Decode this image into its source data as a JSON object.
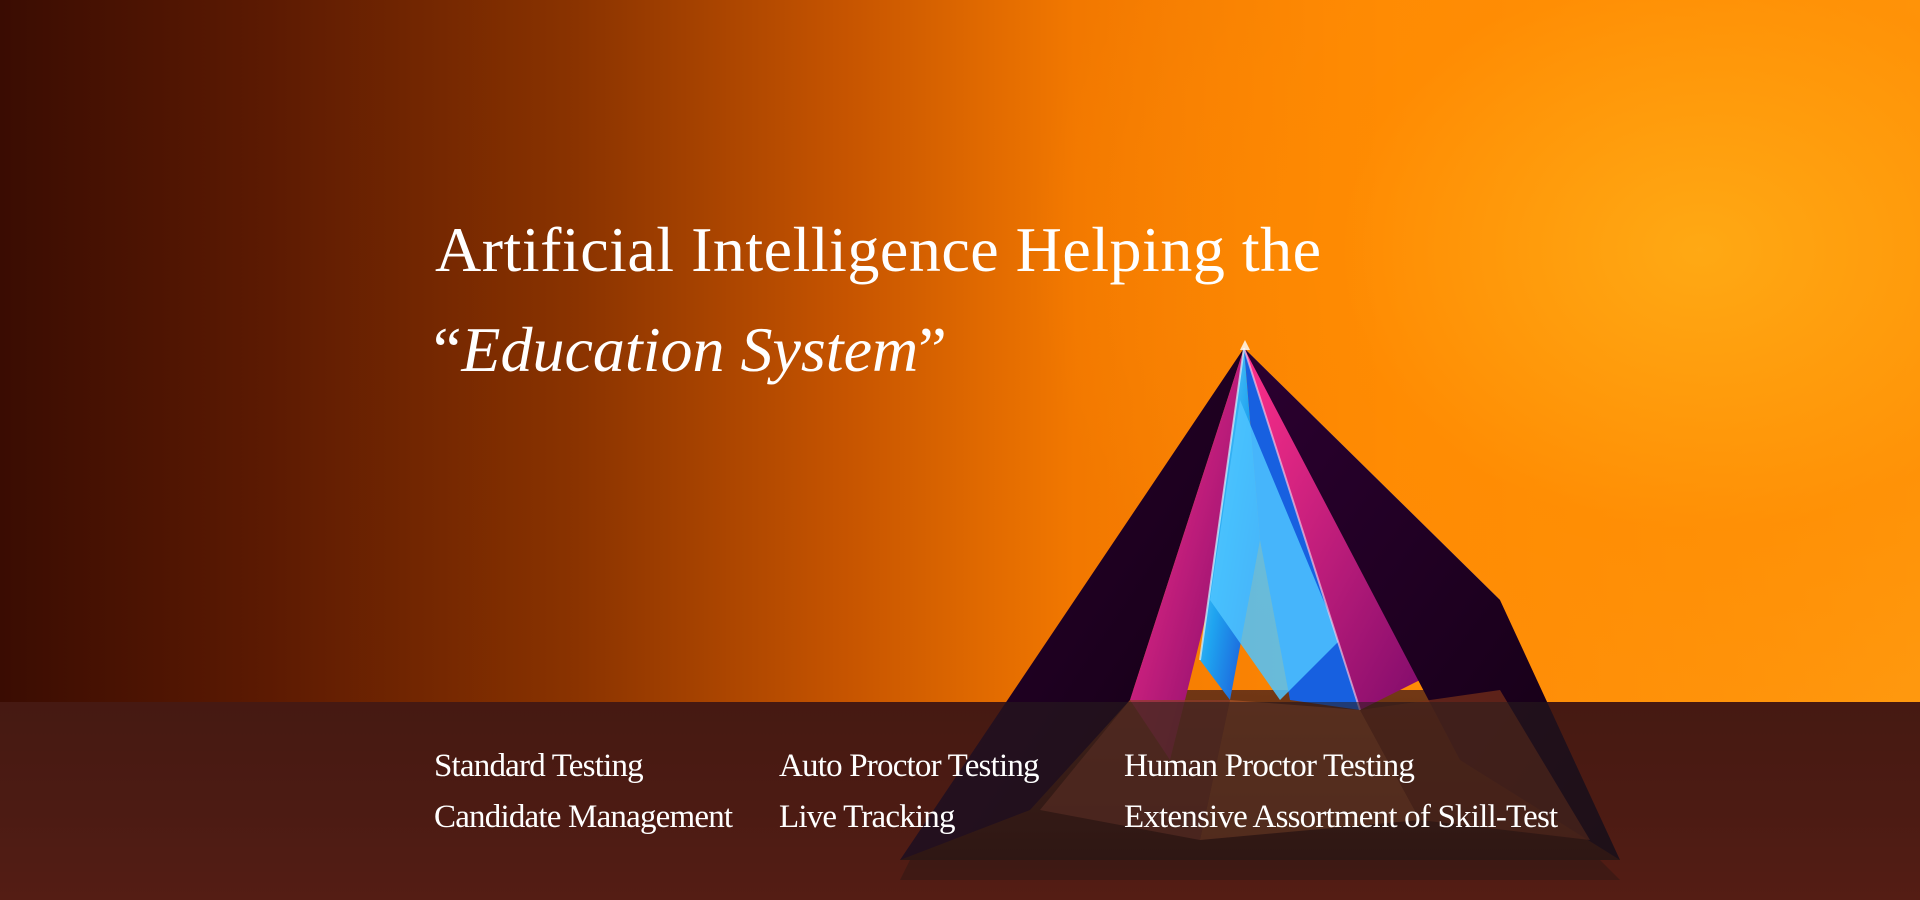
{
  "hero": {
    "headline_line1": "Artificial Intelligence Helping the",
    "headline_open_quote": "“",
    "headline_phrase": "Education System",
    "headline_close_quote": "”"
  },
  "features": [
    "Standard Testing",
    "Auto Proctor Testing",
    "Human Proctor Testing",
    "Candidate Management",
    "Live Tracking",
    "Extensive Assortment of Skill-Test"
  ],
  "colors": {
    "background_left": "#3a0c02",
    "background_right": "#ff9a10",
    "text": "#ffffff",
    "band_overlay": "rgba(40,30,30,0.55)"
  },
  "images": {
    "hero_graphic": "glass-prism-pyramid"
  }
}
